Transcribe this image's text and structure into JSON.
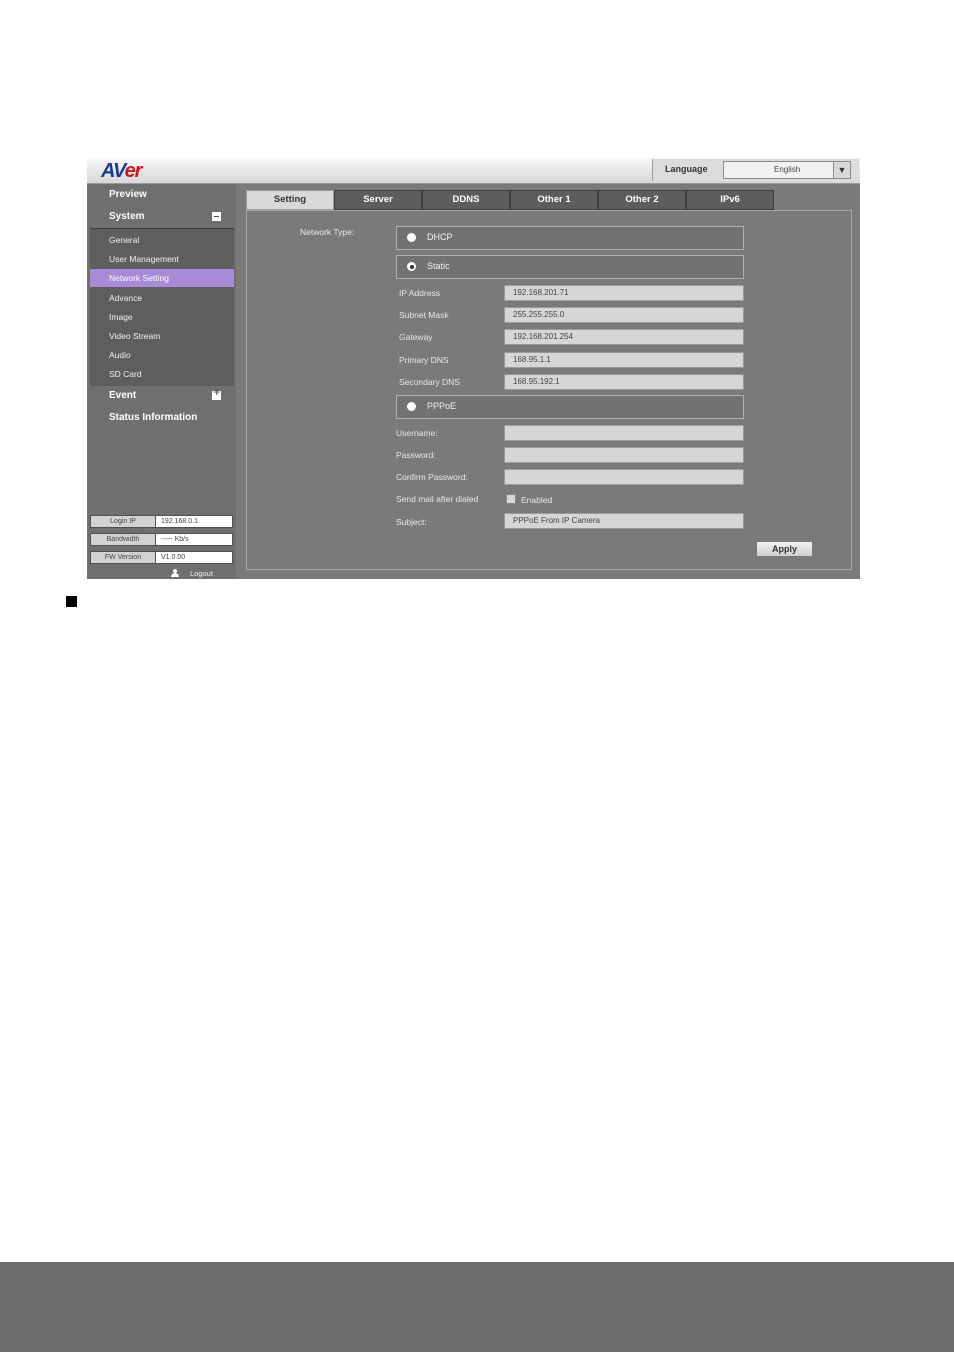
{
  "header": {
    "logo_text_a": "AV",
    "logo_text_b": "er",
    "language_label": "Language",
    "language_value": "English"
  },
  "sidebar": {
    "preview": "Preview",
    "system": "System",
    "items": [
      {
        "label": "General"
      },
      {
        "label": "User Management"
      },
      {
        "label": "Network Setting"
      },
      {
        "label": "Advance"
      },
      {
        "label": "Image"
      },
      {
        "label": "Video Stream"
      },
      {
        "label": "Audio"
      },
      {
        "label": "SD Card"
      }
    ],
    "event": "Event",
    "status": "Status Information",
    "info": {
      "login_ip_label": "Login IP",
      "login_ip_value": "192.168.0.1",
      "bandwidth_label": "Bandwidth",
      "bandwidth_value": "----- Kb/s",
      "fw_label": "FW Version",
      "fw_value": "V1.0.00"
    },
    "logout": "Logout"
  },
  "tabs": [
    "Setting",
    "Server",
    "DDNS",
    "Other 1",
    "Other 2",
    "IPv6"
  ],
  "form": {
    "network_type_label": "Network Type:",
    "dhcp": "DHCP",
    "static": "Static",
    "ip_label": "IP Address",
    "ip_value": "192.168.201.71",
    "mask_label": "Subnet Mask",
    "mask_value": "255.255.255.0",
    "gateway_label": "Gateway",
    "gateway_value": "192.168.201.254",
    "pdns_label": "Primary DNS",
    "pdns_value": "168.95.1.1",
    "sdns_label": "Secondary DNS",
    "sdns_value": "168.95.192.1",
    "pppoe": "PPPoE",
    "username_label": "Username:",
    "username_value": "",
    "password_label": "Password:",
    "password_value": "",
    "confirm_label": "Confirm Password:",
    "confirm_value": "",
    "sendmail_label": "Send mail after dialed",
    "enabled_label": "Enabled",
    "subject_label": "Subject:",
    "subject_value": "PPPoE From IP Camera",
    "apply": "Apply"
  },
  "colors": {
    "active_menu": "#a78ad8",
    "logo_blue": "#1d3c8f",
    "logo_red": "#c8191f"
  }
}
